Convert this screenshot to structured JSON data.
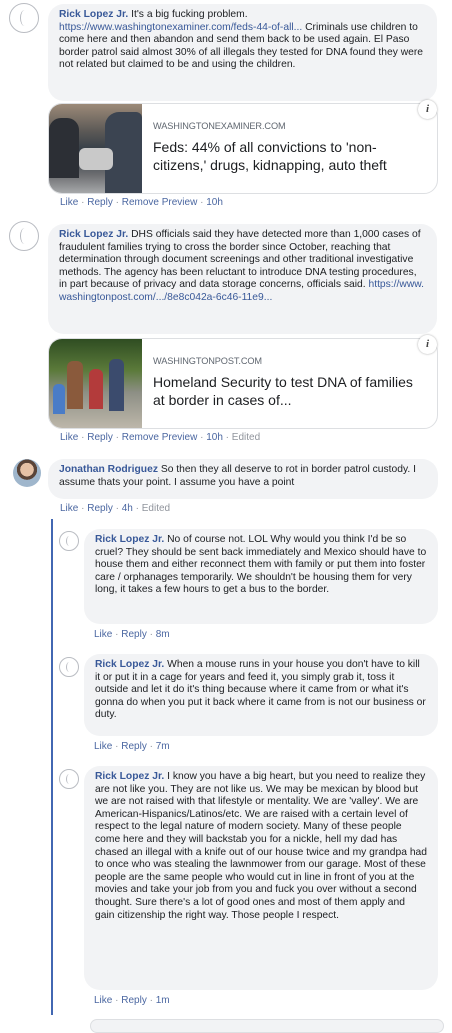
{
  "comments": [
    {
      "author": "Rick Lopez Jr.",
      "text": "It's a big fucking problem.",
      "link": "https://www.washingtonexaminer.com/feds-44-of-all...",
      "text2": "Criminals use children to come here and then abandon and send them back to be used again. El Paso border patrol said almost 30% of all illegals they tested for DNA found they were not related but claimed to be and using the children.",
      "preview": {
        "domain": "WASHINGTONEXAMINER.COM",
        "title": "Feds: 44% of all convictions to 'non-citizens,' drugs, kidnapping, auto theft"
      },
      "actions": [
        "Like",
        "Reply",
        "Remove Preview"
      ],
      "time": "10h"
    },
    {
      "author": "Rick Lopez Jr.",
      "text": "DHS officials said they have detected more than 1,000 cases of fraudulent families trying to cross the border since October, reaching that determination through document screenings and other traditional investigative methods. The agency has been reluctant to introduce DNA testing procedures, in part because of privacy and data storage concerns, officials said.",
      "link": "https://www.washingtonpost.com/.../8e8c042a-6c46-11e9...",
      "preview": {
        "domain": "WASHINGTONPOST.COM",
        "title": "Homeland Security to test DNA of families at border in cases of..."
      },
      "actions": [
        "Like",
        "Reply",
        "Remove Preview"
      ],
      "time": "10h",
      "edited": "Edited"
    },
    {
      "author": "Jonathan Rodriguez",
      "text": "So then they all deserve to rot in border patrol custody. I assume thats your point. I assume you have a point",
      "actions": [
        "Like",
        "Reply"
      ],
      "time": "4h",
      "edited": "Edited"
    }
  ],
  "replies": [
    {
      "author": "Rick Lopez Jr.",
      "text": "No of course not. LOL Why would you think I'd be so cruel? They should be sent back immediately and Mexico should have to house them and either reconnect them with family or put them into foster care / orphanages temporarily. We shouldn't be housing them for very long, it takes a few hours to get a bus to the border.",
      "actions": [
        "Like",
        "Reply"
      ],
      "time": "8m"
    },
    {
      "author": "Rick Lopez Jr.",
      "text": "When a mouse runs in your house you don't have to kill it or put it in a cage for years and feed it, you simply grab it, toss it outside and let it do it's thing because where it came from or what it's gonna do when you put it back where it came from is not our business or duty.",
      "actions": [
        "Like",
        "Reply"
      ],
      "time": "7m"
    },
    {
      "author": "Rick Lopez Jr.",
      "text": "I know you have a big heart, but you need to realize they are not like you. They are not like us. We may be mexican by blood but we are not raised with that lifestyle or mentality. We are 'valley'. We are American-Hispanics/Latinos/etc. We are raised with a certain level of respect to the legal nature of modern society. Many of these people come here and they will backstab you for a nickle, hell my dad has chased an illegal with a knife out of our house twice and my grandpa had to once who was stealing the lawnmower from our garage. Most of these people are the same people who would cut in line in front of you at the movies and take your job from you and fuck you over without a second thought. Sure there's a lot of good ones and most of them apply and gain citizenship the right way. Those people I respect.",
      "actions": [
        "Like",
        "Reply"
      ],
      "time": "1m"
    }
  ],
  "sep": " · ",
  "info_glyph": "i",
  "colors": {
    "name": "#385898",
    "bubble": "#f2f3f5",
    "thread": "#4267b2",
    "meta": "#90949c"
  }
}
